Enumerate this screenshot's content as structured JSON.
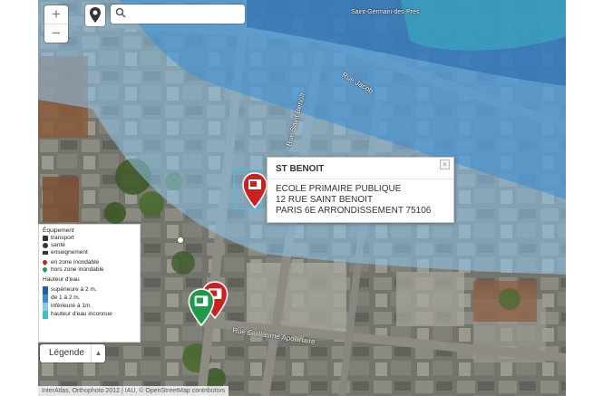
{
  "map": {
    "zoom_in": "+",
    "zoom_out": "−",
    "search_placeholder": "",
    "streets": {
      "jacob": "Rue Jacob",
      "saint_benoit": "Rue Saint Benoît",
      "guillaume": "Rue Guillaume Apollinaire",
      "saint_germain": "Saint-Germain-des-Prés"
    },
    "attribution": "InterAtlas, Orthophoto 2012 | IAU, © OpenStreetMap contributors"
  },
  "popup": {
    "title": "ST BENOIT",
    "line1": "ECOLE PRIMAIRE PUBLIQUE",
    "line2": "12 RUE SAINT BENOIT",
    "line3": "PARIS 6E ARRONDISSEMENT 75106",
    "close": "×"
  },
  "legend": {
    "equipement": "Équipement",
    "transport": "transport",
    "sante": "santé",
    "enseignement": "enseignement",
    "en_zone": "en zone inondable",
    "hors_zone": "hors zone inondable",
    "hauteur": "Hauteur d'eau",
    "sup2": "supérieure à 2 m.",
    "de1a2": "de 1 à 2 m.",
    "inf1": "inférieure à 1m.",
    "inconnue": "hauteur d'eau inconnue",
    "button": "Légende",
    "colors": {
      "sup2": "#1f5fa8",
      "de1a2": "#3b8ed6",
      "inf1": "#8ec7ee",
      "inconnue": "#3ac2c4",
      "red": "#c9221f",
      "green": "#1f9a4b"
    }
  }
}
